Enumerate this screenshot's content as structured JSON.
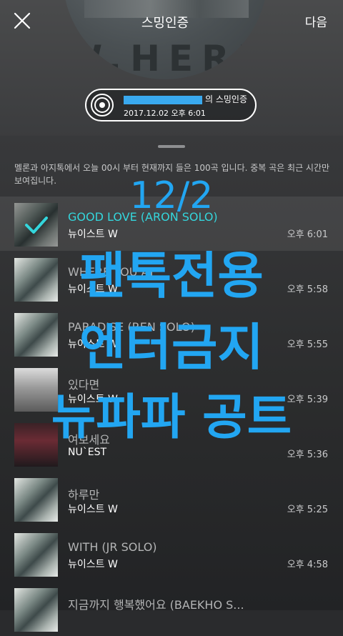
{
  "header": {
    "next_label": "다음"
  },
  "album": {
    "title": "스밍인증",
    "art_text": "W.HERE"
  },
  "badge": {
    "line1_suffix": "의 스밍인증",
    "line2": "2017.12.02 오후 6:01"
  },
  "description": "멜론과 아지톡에서 오늘 00시 부터 현재까지 들은 100곡 입니다. 중복 곡은 최근 시간만 보여집니다.",
  "songs": [
    {
      "title": "GOOD LOVE (ARON SOLO)",
      "artist": "뉴이스트 W",
      "time": "오후 6:01",
      "selected": true
    },
    {
      "title": "WHERE YOU AT",
      "artist": "뉴이스트 W",
      "time": "오후 5:58"
    },
    {
      "title": "PARADISE (REN SOLO)",
      "artist": "뉴이스트 W",
      "time": "오후 5:55"
    },
    {
      "title": "있다면",
      "artist": "뉴이스트 W",
      "time": "오후 5:39"
    },
    {
      "title": "여보세요",
      "artist": "NU`EST",
      "time": "오후 5:36"
    },
    {
      "title": "하루만",
      "artist": "뉴이스트 W",
      "time": "오후 5:25"
    },
    {
      "title": "WITH (JR SOLO)",
      "artist": "뉴이스트 W",
      "time": "오후 4:58"
    },
    {
      "title": "지금까지 행복했어요 (BAEKHO S...",
      "artist": "",
      "time": ""
    }
  ],
  "overlay": {
    "lines": [
      "12/2",
      "팬톡전용",
      "엔터금지",
      "뉴파파 공트"
    ]
  },
  "colors": {
    "accent": "#34d6dc",
    "overlay": "#22a6f2",
    "background": "#2a2b2d"
  },
  "icons": {
    "close": "close-icon",
    "record": "record-disc-icon",
    "check": "check-icon"
  }
}
